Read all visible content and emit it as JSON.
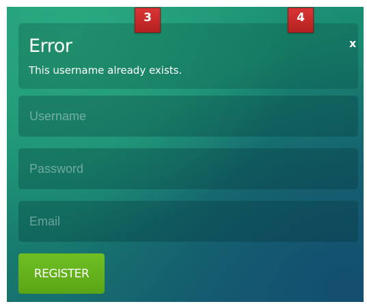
{
  "alert": {
    "title": "Error",
    "message": "This username already exists.",
    "close_label": "x"
  },
  "markers": {
    "first": "3",
    "second": "4"
  },
  "form": {
    "username_placeholder": "Username",
    "password_placeholder": "Password",
    "email_placeholder": "Email",
    "username_value": "",
    "password_value": "",
    "email_value": "",
    "register_label": "REGISTER"
  },
  "colors": {
    "panel_accent": "#1a8b72",
    "button_green": "#5aa516",
    "marker_red": "#c62828"
  }
}
